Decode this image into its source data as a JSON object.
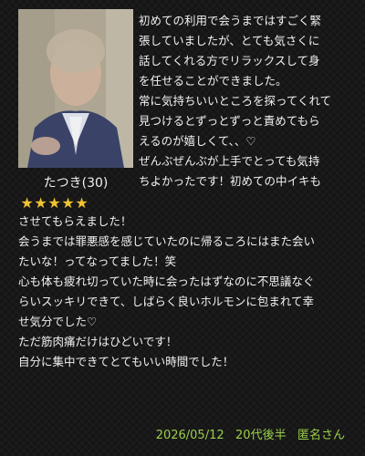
{
  "profile": {
    "name": "たつき",
    "age": "(30)",
    "rating": 5,
    "stars": [
      "★",
      "★",
      "★",
      "★",
      "★"
    ]
  },
  "review": {
    "top_lines": [
      "初めての利用で会うまではすごく緊",
      "張していましたが、とても気さくに",
      "話してくれる方でリラックスして身",
      "を任せることができました。",
      "",
      "常に気持ちいいところを探ってくれて",
      "",
      "見つけるとずっとずっと責めてもら",
      "えるのが嬉しくて、、♡",
      "ぜんぶぜんぶが上手でとっても気持",
      "ちよかったです！初めての中イキも"
    ],
    "bottom_lines": [
      "させてもらえました！",
      "",
      "",
      "",
      "会うまでは罪悪感を感じていたのに帰るころにはまた会い",
      "たいな！ってなってました！笑",
      "心も体も疲れ切っていた時に会ったはずなのに不思議なぐ",
      "らいスッキリできて、しばらく良いホルモンに包まれて幸",
      "せ気分でした♡",
      "ただ筋肉痛だけはひどいです！",
      "",
      "自分に集中できてとてもいい時間でした！"
    ]
  },
  "footer": {
    "date": "2026/05/12",
    "age_group": "20代後半",
    "author": "匿名さん"
  },
  "colors": {
    "background": "#151515",
    "text": "#f2f2f2",
    "star": "#f1c232",
    "footer": "#9bcf4a"
  }
}
